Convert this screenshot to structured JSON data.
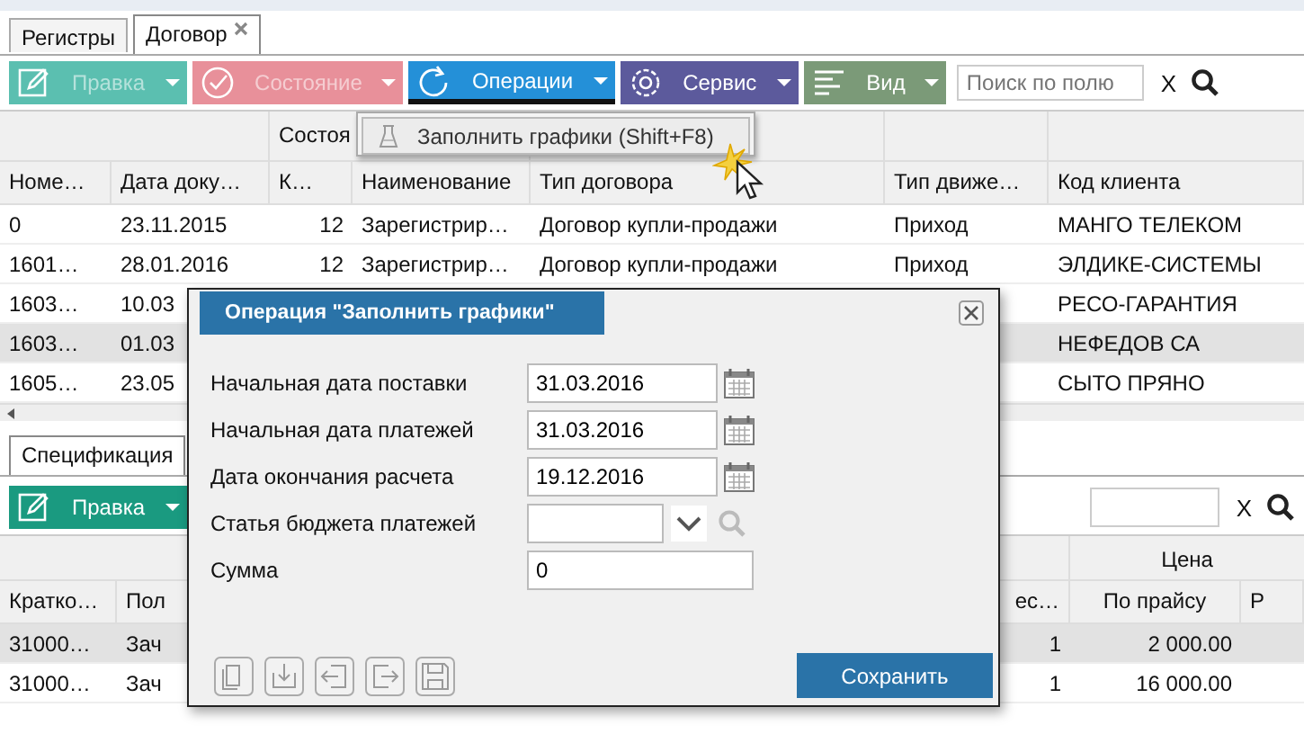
{
  "tabs": [
    {
      "label": "Регистры",
      "selected": false,
      "closable": false
    },
    {
      "label": "Договор",
      "selected": true,
      "closable": true
    }
  ],
  "toolbar": {
    "buttons": [
      {
        "label": "Правка",
        "kind": "edit",
        "color": "#5bbfb0",
        "disabled": true,
        "selected": false
      },
      {
        "label": "Состояние",
        "kind": "state",
        "color": "#e8909a",
        "disabled": true,
        "selected": false
      },
      {
        "label": "Операции",
        "kind": "ops",
        "color": "#2490d8",
        "disabled": false,
        "selected": true
      },
      {
        "label": "Сервис",
        "kind": "service",
        "color": "#5c5a9c",
        "disabled": false,
        "selected": false
      },
      {
        "label": "Вид",
        "kind": "view",
        "color": "#7b9a78",
        "disabled": false,
        "selected": false
      }
    ],
    "search": {
      "placeholder": "Поиск по полю",
      "clear": "X"
    }
  },
  "menu": {
    "items": [
      {
        "label": "Заполнить графики (Shift+F8)"
      }
    ]
  },
  "table": {
    "group_header": "Состоя",
    "columns": [
      "Номе…",
      "Дата доку…",
      "К…",
      "Наименование",
      "Тип договора",
      "Тип движе…",
      "Код клиента"
    ],
    "rows": [
      {
        "cells": [
          "0",
          "23.11.2015",
          "12",
          "Зарегистрир…",
          "Договор купли-продажи",
          "Приход",
          "МАНГО ТЕЛЕКОМ"
        ],
        "selected": false
      },
      {
        "cells": [
          "1601…",
          "28.01.2016",
          "12",
          "Зарегистрир…",
          "Договор купли-продажи",
          "Приход",
          "ЭЛДИКЕ-СИСТЕМЫ"
        ],
        "selected": false
      },
      {
        "cells": [
          "1603…",
          "10.03",
          null,
          null,
          null,
          null,
          "РЕСО-ГАРАНТИЯ"
        ],
        "selected": false
      },
      {
        "cells": [
          "1603…",
          "01.03",
          null,
          null,
          null,
          null,
          "НЕФЕДОВ СА"
        ],
        "selected": true
      },
      {
        "cells": [
          "1605…",
          "23.05",
          null,
          null,
          null,
          null,
          "СЫТО ПРЯНО"
        ],
        "selected": false
      }
    ]
  },
  "detail": {
    "tabs": [
      {
        "label": "Спецификация",
        "selected": true
      }
    ],
    "toolbar": {
      "buttons": [
        {
          "label": "Правка",
          "kind": "edit",
          "color": "#1a9a80",
          "disabled": false,
          "selected": false
        }
      ],
      "search": {
        "clear": "X"
      }
    },
    "table": {
      "group_header": "Цена",
      "columns": [
        "Кратко…",
        "Пол",
        "ес…",
        "По прайсу",
        "Р"
      ],
      "rows": [
        {
          "cells": [
            "31000…",
            "Зач",
            "1",
            "2 000.00"
          ],
          "selected": true
        },
        {
          "cells": [
            "31000…",
            "Зач",
            "1",
            "16 000.00"
          ],
          "selected": false
        }
      ]
    }
  },
  "dialog": {
    "title": "Операция \"Заполнить графики\"",
    "fields": [
      {
        "label": "Начальная дата поставки",
        "value": "31.03.2016",
        "kind": "date"
      },
      {
        "label": "Начальная дата платежей",
        "value": "31.03.2016",
        "kind": "date"
      },
      {
        "label": "Дата окончания расчета",
        "value": "19.12.2016",
        "kind": "date"
      },
      {
        "label": "Статья бюджета платежей",
        "kind": "select"
      },
      {
        "label": "Сумма",
        "value": "0",
        "kind": "text"
      }
    ],
    "save": "Сохранить"
  }
}
